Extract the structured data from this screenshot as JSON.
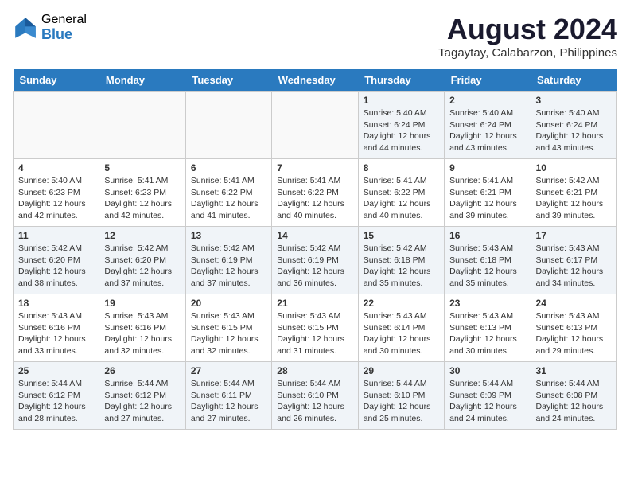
{
  "header": {
    "logo_general": "General",
    "logo_blue": "Blue",
    "month_year": "August 2024",
    "location": "Tagaytay, Calabarzon, Philippines"
  },
  "days_of_week": [
    "Sunday",
    "Monday",
    "Tuesday",
    "Wednesday",
    "Thursday",
    "Friday",
    "Saturday"
  ],
  "weeks": [
    [
      {
        "day": "",
        "content": ""
      },
      {
        "day": "",
        "content": ""
      },
      {
        "day": "",
        "content": ""
      },
      {
        "day": "",
        "content": ""
      },
      {
        "day": "1",
        "content": "Sunrise: 5:40 AM\nSunset: 6:24 PM\nDaylight: 12 hours\nand 44 minutes."
      },
      {
        "day": "2",
        "content": "Sunrise: 5:40 AM\nSunset: 6:24 PM\nDaylight: 12 hours\nand 43 minutes."
      },
      {
        "day": "3",
        "content": "Sunrise: 5:40 AM\nSunset: 6:24 PM\nDaylight: 12 hours\nand 43 minutes."
      }
    ],
    [
      {
        "day": "4",
        "content": "Sunrise: 5:40 AM\nSunset: 6:23 PM\nDaylight: 12 hours\nand 42 minutes."
      },
      {
        "day": "5",
        "content": "Sunrise: 5:41 AM\nSunset: 6:23 PM\nDaylight: 12 hours\nand 42 minutes."
      },
      {
        "day": "6",
        "content": "Sunrise: 5:41 AM\nSunset: 6:22 PM\nDaylight: 12 hours\nand 41 minutes."
      },
      {
        "day": "7",
        "content": "Sunrise: 5:41 AM\nSunset: 6:22 PM\nDaylight: 12 hours\nand 40 minutes."
      },
      {
        "day": "8",
        "content": "Sunrise: 5:41 AM\nSunset: 6:22 PM\nDaylight: 12 hours\nand 40 minutes."
      },
      {
        "day": "9",
        "content": "Sunrise: 5:41 AM\nSunset: 6:21 PM\nDaylight: 12 hours\nand 39 minutes."
      },
      {
        "day": "10",
        "content": "Sunrise: 5:42 AM\nSunset: 6:21 PM\nDaylight: 12 hours\nand 39 minutes."
      }
    ],
    [
      {
        "day": "11",
        "content": "Sunrise: 5:42 AM\nSunset: 6:20 PM\nDaylight: 12 hours\nand 38 minutes."
      },
      {
        "day": "12",
        "content": "Sunrise: 5:42 AM\nSunset: 6:20 PM\nDaylight: 12 hours\nand 37 minutes."
      },
      {
        "day": "13",
        "content": "Sunrise: 5:42 AM\nSunset: 6:19 PM\nDaylight: 12 hours\nand 37 minutes."
      },
      {
        "day": "14",
        "content": "Sunrise: 5:42 AM\nSunset: 6:19 PM\nDaylight: 12 hours\nand 36 minutes."
      },
      {
        "day": "15",
        "content": "Sunrise: 5:42 AM\nSunset: 6:18 PM\nDaylight: 12 hours\nand 35 minutes."
      },
      {
        "day": "16",
        "content": "Sunrise: 5:43 AM\nSunset: 6:18 PM\nDaylight: 12 hours\nand 35 minutes."
      },
      {
        "day": "17",
        "content": "Sunrise: 5:43 AM\nSunset: 6:17 PM\nDaylight: 12 hours\nand 34 minutes."
      }
    ],
    [
      {
        "day": "18",
        "content": "Sunrise: 5:43 AM\nSunset: 6:16 PM\nDaylight: 12 hours\nand 33 minutes."
      },
      {
        "day": "19",
        "content": "Sunrise: 5:43 AM\nSunset: 6:16 PM\nDaylight: 12 hours\nand 32 minutes."
      },
      {
        "day": "20",
        "content": "Sunrise: 5:43 AM\nSunset: 6:15 PM\nDaylight: 12 hours\nand 32 minutes."
      },
      {
        "day": "21",
        "content": "Sunrise: 5:43 AM\nSunset: 6:15 PM\nDaylight: 12 hours\nand 31 minutes."
      },
      {
        "day": "22",
        "content": "Sunrise: 5:43 AM\nSunset: 6:14 PM\nDaylight: 12 hours\nand 30 minutes."
      },
      {
        "day": "23",
        "content": "Sunrise: 5:43 AM\nSunset: 6:13 PM\nDaylight: 12 hours\nand 30 minutes."
      },
      {
        "day": "24",
        "content": "Sunrise: 5:43 AM\nSunset: 6:13 PM\nDaylight: 12 hours\nand 29 minutes."
      }
    ],
    [
      {
        "day": "25",
        "content": "Sunrise: 5:44 AM\nSunset: 6:12 PM\nDaylight: 12 hours\nand 28 minutes."
      },
      {
        "day": "26",
        "content": "Sunrise: 5:44 AM\nSunset: 6:12 PM\nDaylight: 12 hours\nand 27 minutes."
      },
      {
        "day": "27",
        "content": "Sunrise: 5:44 AM\nSunset: 6:11 PM\nDaylight: 12 hours\nand 27 minutes."
      },
      {
        "day": "28",
        "content": "Sunrise: 5:44 AM\nSunset: 6:10 PM\nDaylight: 12 hours\nand 26 minutes."
      },
      {
        "day": "29",
        "content": "Sunrise: 5:44 AM\nSunset: 6:10 PM\nDaylight: 12 hours\nand 25 minutes."
      },
      {
        "day": "30",
        "content": "Sunrise: 5:44 AM\nSunset: 6:09 PM\nDaylight: 12 hours\nand 24 minutes."
      },
      {
        "day": "31",
        "content": "Sunrise: 5:44 AM\nSunset: 6:08 PM\nDaylight: 12 hours\nand 24 minutes."
      }
    ]
  ]
}
